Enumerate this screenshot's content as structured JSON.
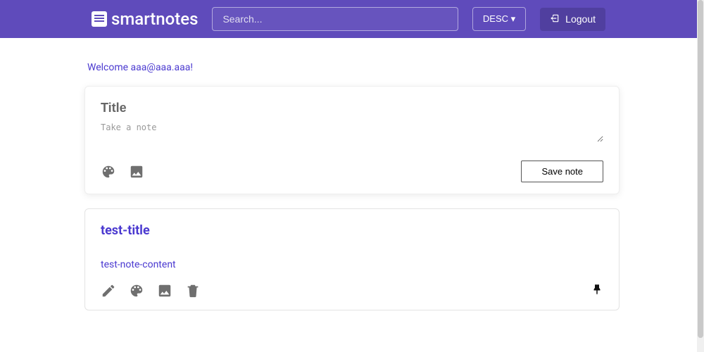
{
  "brand": "smartnotes",
  "search": {
    "placeholder": "Search..."
  },
  "sort_label": "DESC ▾",
  "logout_label": "Logout",
  "welcome_text": "Welcome aaa@aaa.aaa!",
  "create": {
    "title_placeholder": "Title",
    "body_placeholder": "Take a note",
    "save_label": "Save note"
  },
  "notes": [
    {
      "title": "test-title",
      "content": "test-note-content"
    }
  ]
}
